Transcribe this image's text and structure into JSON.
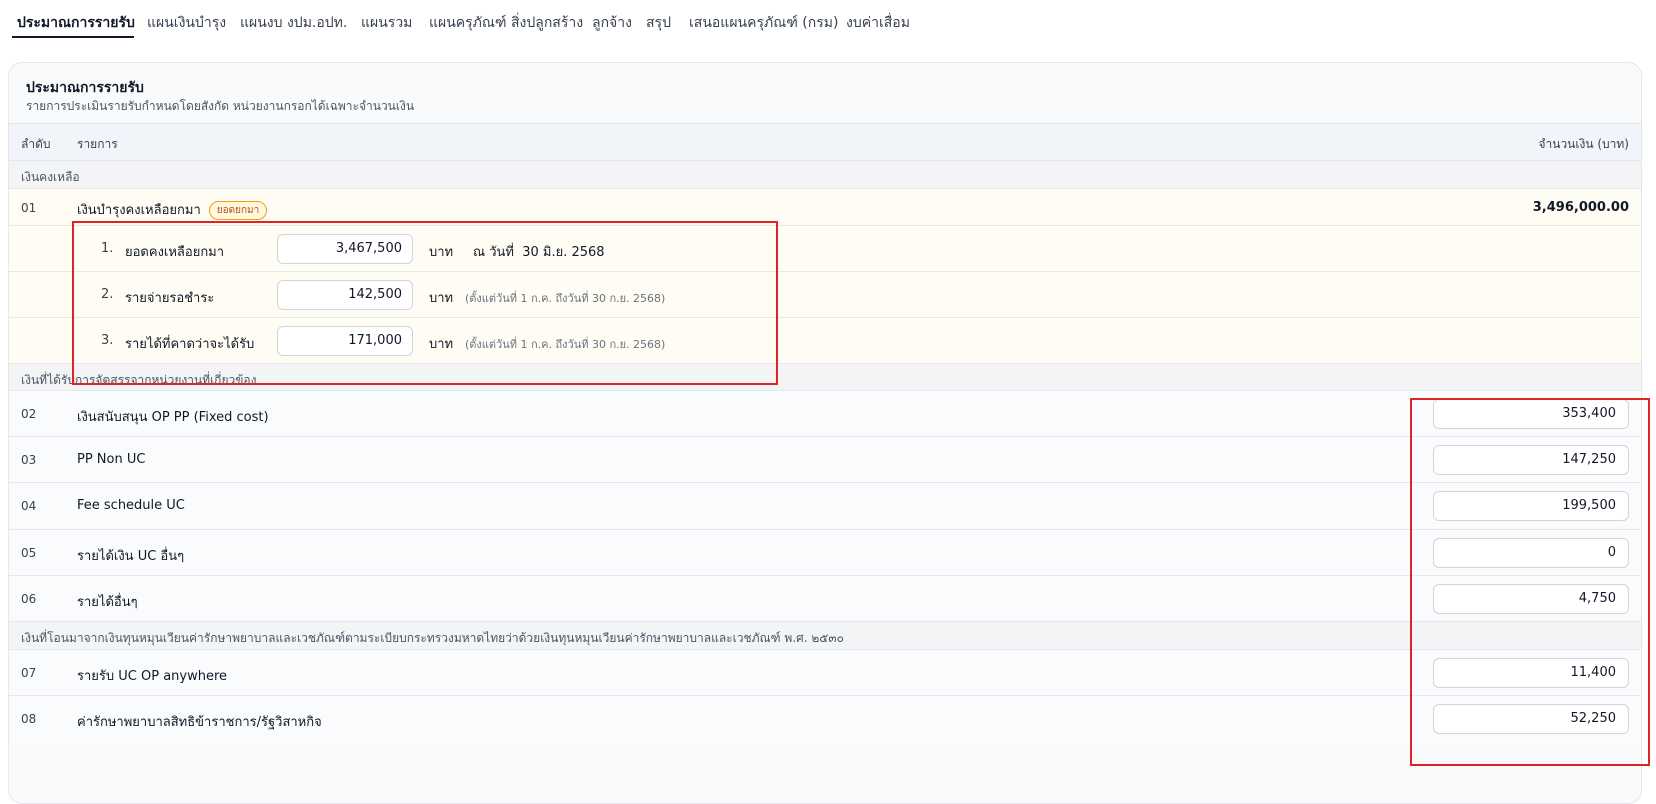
{
  "tabs": [
    {
      "label": "ประมาณการรายรับ",
      "active": true
    },
    {
      "label": "แผนเงินบำรุง"
    },
    {
      "label": "แผนงบ งปม.อปท."
    },
    {
      "label": "แผนรวม"
    },
    {
      "label": "แผนครุภัณฑ์ สิ่งปลูกสร้าง"
    },
    {
      "label": "ลูกจ้าง"
    },
    {
      "label": "สรุป"
    },
    {
      "label": "เสนอแผนครุภัณฑ์ (กรม)"
    },
    {
      "label": "งบค่าเสื่อม"
    }
  ],
  "card": {
    "title": "ประมาณการรายรับ",
    "subtitle": "รายการประเมินรายรับกำหนดโดยสังกัด หน่วยงานกรอกได้เฉพาะจำนวนเงิน"
  },
  "table_header": {
    "no": "ลำดับ",
    "name": "รายการ",
    "amount": "จำนวนเงิน (บาท)"
  },
  "group1": {
    "label": "เงินคงเหลือ",
    "row": {
      "no": "01",
      "name": "เงินบำรุงคงเหลือยกมา",
      "badge": "ยอดยกมา",
      "total": "3,496,000.00"
    },
    "sub": [
      {
        "no": "1.",
        "label": "ยอดคงเหลือยกมา",
        "value": "3,467,500",
        "unit": "บาท",
        "asof": "ณ วันที่  30 มิ.ย. 2568"
      },
      {
        "no": "2.",
        "label": "รายจ่ายรอชำระ",
        "value": "142,500",
        "unit": "บาท",
        "note": "(ตั้งแต่วันที่ 1 ก.ค. ถึงวันที่ 30 ก.ย. 2568)"
      },
      {
        "no": "3.",
        "label": "รายได้ที่คาดว่าจะได้รับ",
        "value": "171,000",
        "unit": "บาท",
        "note": "(ตั้งแต่วันที่ 1 ก.ค. ถึงวันที่ 30 ก.ย. 2568)"
      }
    ]
  },
  "group2": {
    "label": "เงินที่ได้รับการจัดสรรจากหน่วยงานที่เกี่ยวข้อง",
    "rows": [
      {
        "no": "02",
        "name": "เงินสนับสนุน OP PP (Fixed cost)",
        "value": "353,400"
      },
      {
        "no": "03",
        "name": "PP Non UC",
        "value": "147,250"
      },
      {
        "no": "04",
        "name": "Fee schedule UC",
        "value": "199,500"
      },
      {
        "no": "05",
        "name": "รายได้เงิน UC อื่นๆ",
        "value": "0"
      },
      {
        "no": "06",
        "name": "รายได้อื่นๆ",
        "value": "4,750"
      }
    ]
  },
  "group3": {
    "label": "เงินที่โอนมาจากเงินทุนหมุนเวียนค่ารักษาพยาบาลและเวชภัณฑ์ตามระเบียบกระทรวงมหาดไทยว่าด้วยเงินทุนหมุนเวียนค่ารักษาพยาบาลและเวชภัณฑ์ พ.ศ. ๒๕๓๐",
    "rows": [
      {
        "no": "07",
        "name": "รายรับ UC OP anywhere",
        "value": "11,400"
      },
      {
        "no": "08",
        "name": "ค่ารักษาพยาบาลสิทธิข้าราชการ/รัฐวิสาหกิจ",
        "value": "52,250"
      }
    ]
  },
  "colors": {
    "highlight": "#e02424",
    "badge": "#f59e0b",
    "active_tab": "#111827"
  }
}
